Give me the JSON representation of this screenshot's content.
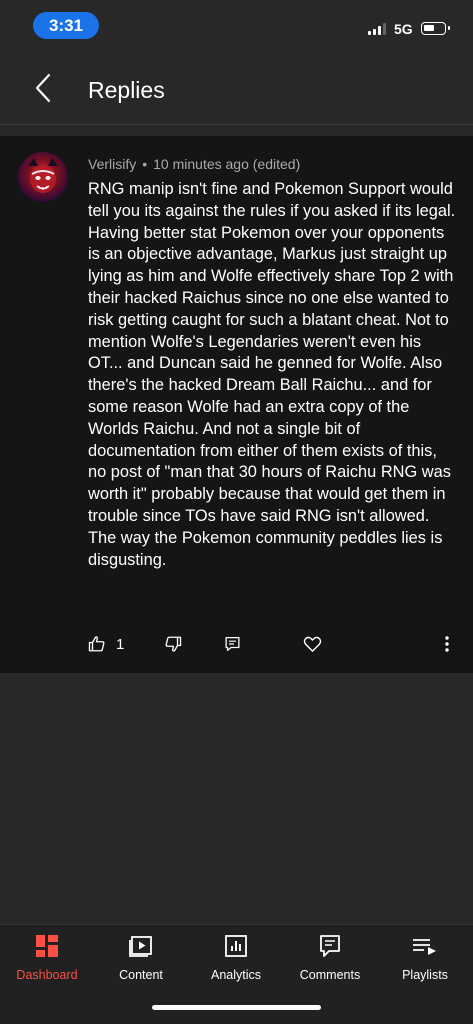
{
  "status_bar": {
    "time": "3:31",
    "network": "5G",
    "icons": [
      "signal-icon",
      "battery-icon"
    ]
  },
  "header": {
    "title": "Replies",
    "back_icon": "chevron-left-icon"
  },
  "comment": {
    "author": "Verlisify",
    "separator": "•",
    "time": "10 minutes ago (edited)",
    "paragraphs": [
      "RNG manip isn't fine and Pokemon Support would tell you its against the rules if you asked if its legal. Having better stat Pokemon over your opponents is an objective advantage, Markus just straight up lying as him and Wolfe effectively share Top 2 with their hacked Raichus since no one else wanted to risk getting caught for such a blatant cheat. Not to mention Wolfe's Legendaries weren't even his OT... and Duncan said he genned for Wolfe. Also there's the hacked Dream Ball Raichu... and for some reason Wolfe had an extra copy of the Worlds Raichu. And not a single bit of documentation from either of them exists of this, no post of \"man that 30 hours of Raichu RNG was worth it\" probably because that would get them in trouble since TOs have said RNG isn't allowed.",
      "The way the Pokemon community peddles lies is disgusting."
    ],
    "like_count": "1",
    "action_icons": [
      "thumbs-up-icon",
      "thumbs-down-icon",
      "reply-icon",
      "heart-icon",
      "more-vert-icon"
    ]
  },
  "bottom_nav": {
    "items": [
      {
        "label": "Dashboard",
        "icon": "dashboard-icon",
        "active": true
      },
      {
        "label": "Content",
        "icon": "content-icon",
        "active": false
      },
      {
        "label": "Analytics",
        "icon": "analytics-icon",
        "active": false
      },
      {
        "label": "Comments",
        "icon": "comments-icon",
        "active": false
      },
      {
        "label": "Playlists",
        "icon": "playlists-icon",
        "active": false
      }
    ]
  },
  "colors": {
    "background": "#282828",
    "card": "#151515",
    "accent": "#ff4e45",
    "time_pill": "#1a73e8",
    "meta_text": "#aaaaaa"
  }
}
